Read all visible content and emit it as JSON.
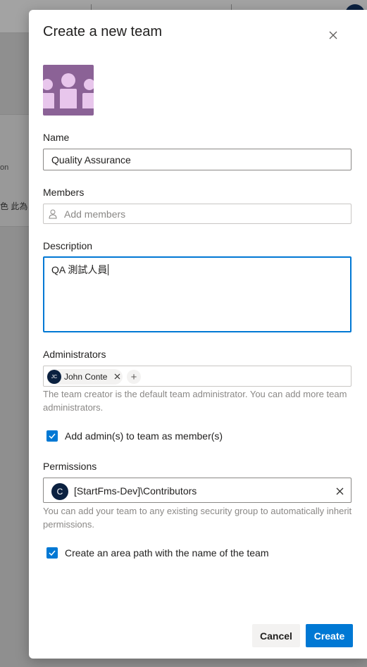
{
  "background": {
    "text_fragment_1": "on",
    "text_fragment_2": "色 此為"
  },
  "dialog": {
    "title": "Create a new team",
    "name": {
      "label": "Name",
      "value": "Quality Assurance"
    },
    "members": {
      "label": "Members",
      "placeholder": "Add members"
    },
    "description": {
      "label": "Description",
      "value": "QA 測試人員"
    },
    "administrators": {
      "label": "Administrators",
      "chips": [
        {
          "initials": "JC",
          "name": "John Conte"
        }
      ],
      "add_symbol": "+",
      "help": "The team creator is the default team administrator. You can add more team administrators."
    },
    "add_admins_checkbox": {
      "label": "Add admin(s) to team as member(s)",
      "checked": true
    },
    "permissions": {
      "label": "Permissions",
      "avatar_letter": "C",
      "value": "[StartFms-Dev]\\Contributors",
      "help": "You can add your team to any existing security group to automatically inherit permissions."
    },
    "area_path_checkbox": {
      "label": "Create an area path with the name of the team",
      "checked": true
    },
    "buttons": {
      "cancel": "Cancel",
      "create": "Create"
    }
  },
  "colors": {
    "accent": "#0078d4",
    "team_image_bg": "#8b6296",
    "avatar_bg": "#0b2140"
  },
  "icons": [
    "close-icon",
    "team-group-icon",
    "person-icon",
    "remove-icon",
    "add-icon",
    "checkmark-icon"
  ]
}
